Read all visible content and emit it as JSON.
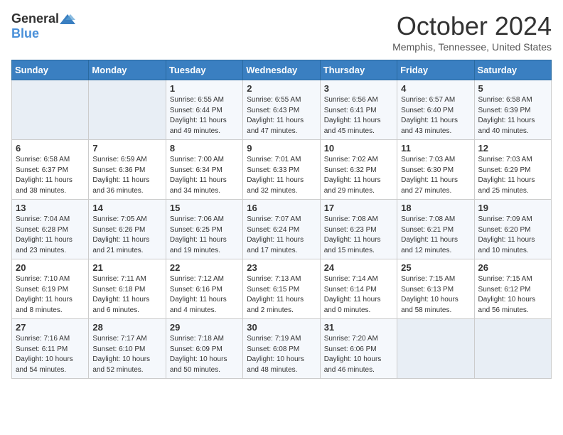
{
  "header": {
    "logo_general": "General",
    "logo_blue": "Blue",
    "month_title": "October 2024",
    "location": "Memphis, Tennessee, United States"
  },
  "days_of_week": [
    "Sunday",
    "Monday",
    "Tuesday",
    "Wednesday",
    "Thursday",
    "Friday",
    "Saturday"
  ],
  "weeks": [
    [
      {
        "day": "",
        "info": ""
      },
      {
        "day": "",
        "info": ""
      },
      {
        "day": "1",
        "info": "Sunrise: 6:55 AM\nSunset: 6:44 PM\nDaylight: 11 hours and 49 minutes."
      },
      {
        "day": "2",
        "info": "Sunrise: 6:55 AM\nSunset: 6:43 PM\nDaylight: 11 hours and 47 minutes."
      },
      {
        "day": "3",
        "info": "Sunrise: 6:56 AM\nSunset: 6:41 PM\nDaylight: 11 hours and 45 minutes."
      },
      {
        "day": "4",
        "info": "Sunrise: 6:57 AM\nSunset: 6:40 PM\nDaylight: 11 hours and 43 minutes."
      },
      {
        "day": "5",
        "info": "Sunrise: 6:58 AM\nSunset: 6:39 PM\nDaylight: 11 hours and 40 minutes."
      }
    ],
    [
      {
        "day": "6",
        "info": "Sunrise: 6:58 AM\nSunset: 6:37 PM\nDaylight: 11 hours and 38 minutes."
      },
      {
        "day": "7",
        "info": "Sunrise: 6:59 AM\nSunset: 6:36 PM\nDaylight: 11 hours and 36 minutes."
      },
      {
        "day": "8",
        "info": "Sunrise: 7:00 AM\nSunset: 6:34 PM\nDaylight: 11 hours and 34 minutes."
      },
      {
        "day": "9",
        "info": "Sunrise: 7:01 AM\nSunset: 6:33 PM\nDaylight: 11 hours and 32 minutes."
      },
      {
        "day": "10",
        "info": "Sunrise: 7:02 AM\nSunset: 6:32 PM\nDaylight: 11 hours and 29 minutes."
      },
      {
        "day": "11",
        "info": "Sunrise: 7:03 AM\nSunset: 6:30 PM\nDaylight: 11 hours and 27 minutes."
      },
      {
        "day": "12",
        "info": "Sunrise: 7:03 AM\nSunset: 6:29 PM\nDaylight: 11 hours and 25 minutes."
      }
    ],
    [
      {
        "day": "13",
        "info": "Sunrise: 7:04 AM\nSunset: 6:28 PM\nDaylight: 11 hours and 23 minutes."
      },
      {
        "day": "14",
        "info": "Sunrise: 7:05 AM\nSunset: 6:26 PM\nDaylight: 11 hours and 21 minutes."
      },
      {
        "day": "15",
        "info": "Sunrise: 7:06 AM\nSunset: 6:25 PM\nDaylight: 11 hours and 19 minutes."
      },
      {
        "day": "16",
        "info": "Sunrise: 7:07 AM\nSunset: 6:24 PM\nDaylight: 11 hours and 17 minutes."
      },
      {
        "day": "17",
        "info": "Sunrise: 7:08 AM\nSunset: 6:23 PM\nDaylight: 11 hours and 15 minutes."
      },
      {
        "day": "18",
        "info": "Sunrise: 7:08 AM\nSunset: 6:21 PM\nDaylight: 11 hours and 12 minutes."
      },
      {
        "day": "19",
        "info": "Sunrise: 7:09 AM\nSunset: 6:20 PM\nDaylight: 11 hours and 10 minutes."
      }
    ],
    [
      {
        "day": "20",
        "info": "Sunrise: 7:10 AM\nSunset: 6:19 PM\nDaylight: 11 hours and 8 minutes."
      },
      {
        "day": "21",
        "info": "Sunrise: 7:11 AM\nSunset: 6:18 PM\nDaylight: 11 hours and 6 minutes."
      },
      {
        "day": "22",
        "info": "Sunrise: 7:12 AM\nSunset: 6:16 PM\nDaylight: 11 hours and 4 minutes."
      },
      {
        "day": "23",
        "info": "Sunrise: 7:13 AM\nSunset: 6:15 PM\nDaylight: 11 hours and 2 minutes."
      },
      {
        "day": "24",
        "info": "Sunrise: 7:14 AM\nSunset: 6:14 PM\nDaylight: 11 hours and 0 minutes."
      },
      {
        "day": "25",
        "info": "Sunrise: 7:15 AM\nSunset: 6:13 PM\nDaylight: 10 hours and 58 minutes."
      },
      {
        "day": "26",
        "info": "Sunrise: 7:15 AM\nSunset: 6:12 PM\nDaylight: 10 hours and 56 minutes."
      }
    ],
    [
      {
        "day": "27",
        "info": "Sunrise: 7:16 AM\nSunset: 6:11 PM\nDaylight: 10 hours and 54 minutes."
      },
      {
        "day": "28",
        "info": "Sunrise: 7:17 AM\nSunset: 6:10 PM\nDaylight: 10 hours and 52 minutes."
      },
      {
        "day": "29",
        "info": "Sunrise: 7:18 AM\nSunset: 6:09 PM\nDaylight: 10 hours and 50 minutes."
      },
      {
        "day": "30",
        "info": "Sunrise: 7:19 AM\nSunset: 6:08 PM\nDaylight: 10 hours and 48 minutes."
      },
      {
        "day": "31",
        "info": "Sunrise: 7:20 AM\nSunset: 6:06 PM\nDaylight: 10 hours and 46 minutes."
      },
      {
        "day": "",
        "info": ""
      },
      {
        "day": "",
        "info": ""
      }
    ]
  ]
}
